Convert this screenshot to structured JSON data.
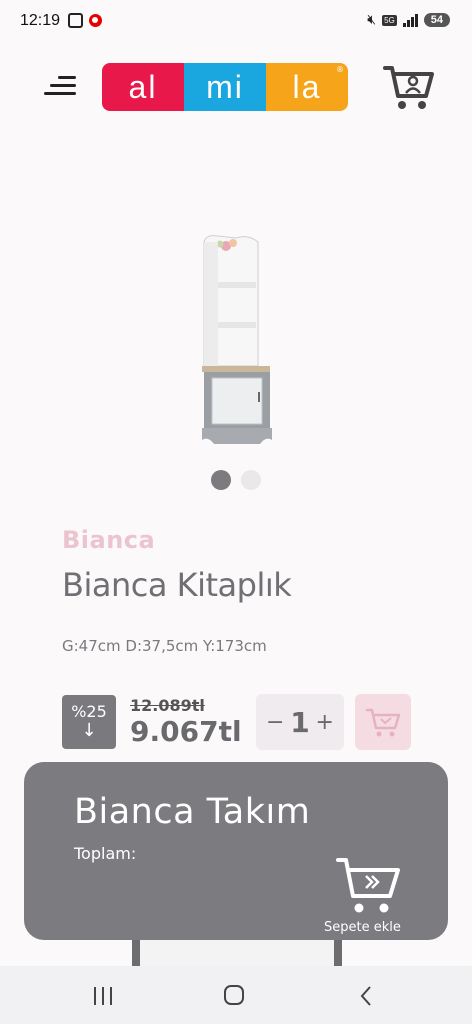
{
  "status_bar": {
    "time": "12:19",
    "network": "5G",
    "battery": "54"
  },
  "header": {
    "logo_segments": [
      "al",
      "mi",
      "la"
    ],
    "logo_colors": [
      "#e8194a",
      "#1aa6df",
      "#f6a419"
    ],
    "menu_icon": "menu-icon",
    "cart_icon": "cart-user-icon"
  },
  "product": {
    "brand": "Bianca",
    "title": "Bianca Kitaplık",
    "dimensions": "G:47cm D:37,5cm Y:173cm",
    "discount": "%25",
    "old_price": "12.089tl",
    "new_price": "9.067tl",
    "quantity": "1",
    "carousel_count": 2,
    "carousel_active": 1
  },
  "stepper": {
    "minus": "−",
    "plus": "+"
  },
  "set_panel": {
    "title": "Bianca Takım",
    "total_label": "Toplam:",
    "add_label": "Sepete ekle"
  },
  "colors": {
    "accent_pink": "#ecc4cf",
    "panel_gray": "#7b7b80",
    "text_gray": "#6f6f74"
  }
}
